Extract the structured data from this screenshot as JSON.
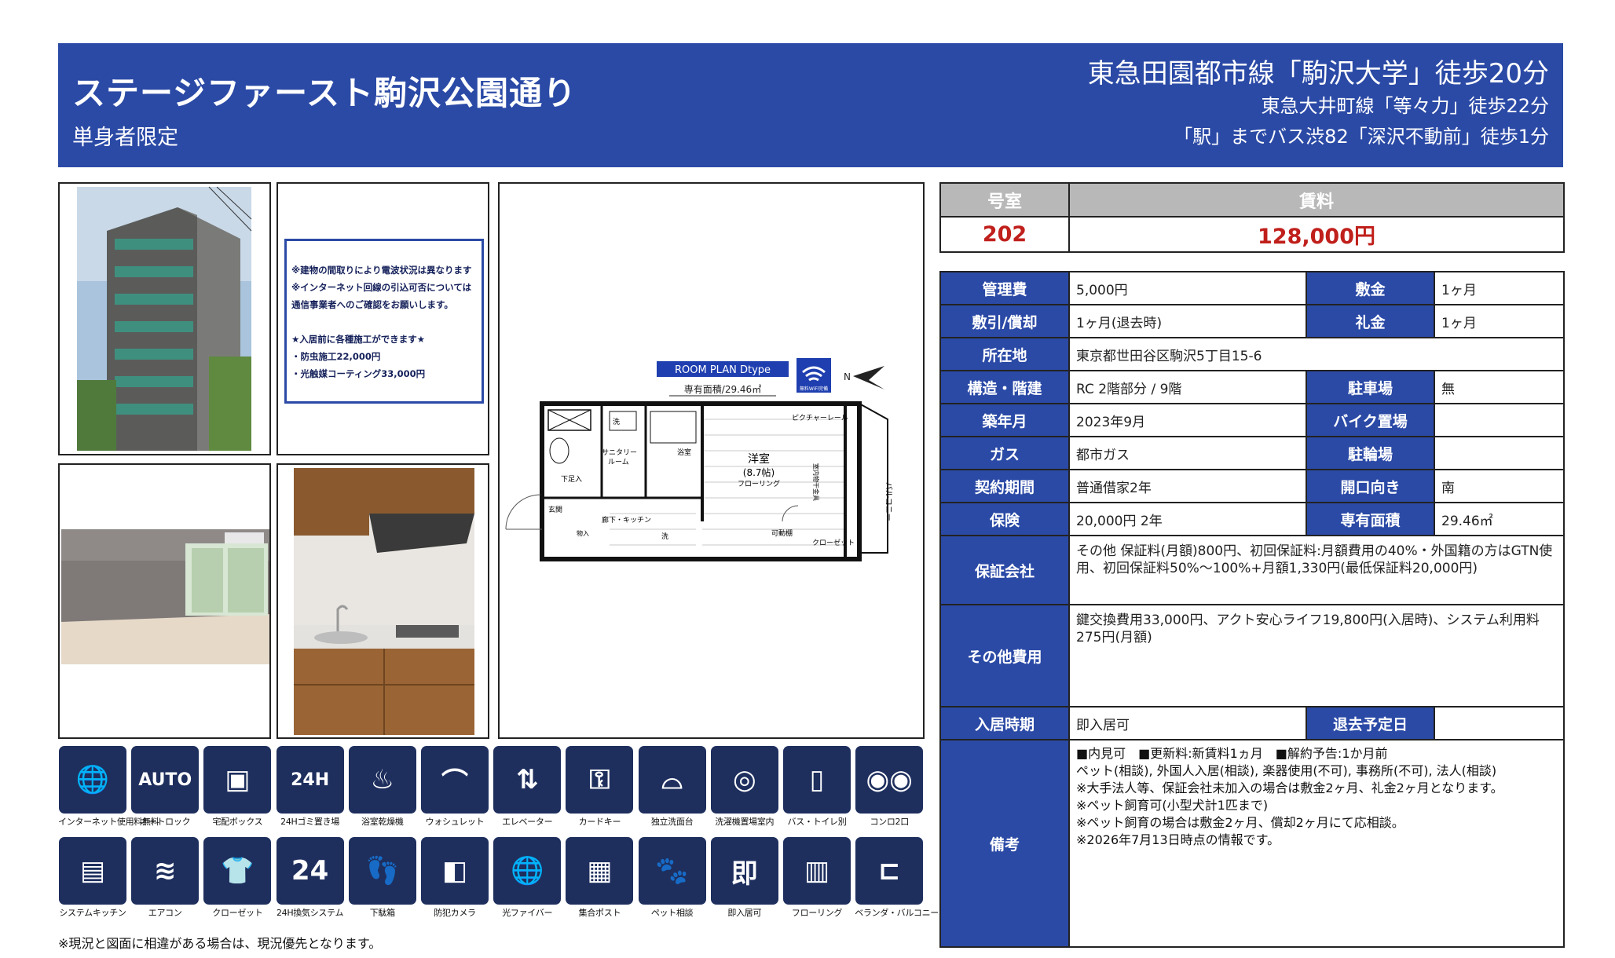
{
  "header": {
    "property_name": "ステージファースト駒沢公園通り",
    "restriction": "単身者限定",
    "access1": "東急田園都市線「駒沢大学」徒歩20分",
    "access2": "東急大井町線「等々力」徒歩22分",
    "access3": "「駅」までバス渋82「深沢不動前」徒歩1分"
  },
  "notice": {
    "lines": [
      "※建物の間取りにより電波状況は異なります",
      "※インターネット回線の引込可否については",
      "通信事業者へのご確認をお願いします。",
      "",
      "★入居前に各種施工ができます★",
      "・防虫施工22,000円",
      "・光触媒コーティング33,000円"
    ]
  },
  "floor_plan": {
    "badge": "ROOM PLAN  Dtype",
    "area": "専有面積/29.46㎡",
    "wifi_label": "無料WiFi完備",
    "north": "N",
    "room_yoshitsu": "洋室",
    "room_size": "(8.7帖)",
    "room_floor": "フローリング",
    "sanitary": "サニタリー",
    "sanitary2": "ルーム",
    "bath": "浴室",
    "wash": "洗",
    "geta": "下足入",
    "genkan": "玄関",
    "hall": "廊下・キッチン",
    "picture_rail": "ピクチャーレール",
    "closet": "クローゼット",
    "movable_shelf": "可動棚",
    "balcony": "バルコニー",
    "storage": "物入",
    "laundry": "洗",
    "indoor_clothes": "室内物干金具"
  },
  "rent": {
    "room_header": "号室",
    "rent_header": "賃料",
    "room": "202",
    "rent": "128,000円"
  },
  "info": {
    "kanrihi_label": "管理費",
    "kanrihi": "5,000円",
    "shikikin_label": "敷金",
    "shikikin": "1ヶ月",
    "shikibiki_label": "敷引/償却",
    "shikibiki": "1ヶ月(退去時)",
    "reikin_label": "礼金",
    "reikin": "1ヶ月",
    "address_label": "所在地",
    "address": "東京都世田谷区駒沢5丁目15-6",
    "structure_label": "構造・階建",
    "structure": "RC 2階部分 / 9階",
    "parking_label": "駐車場",
    "parking": "無",
    "built_label": "築年月",
    "built": "2023年9月",
    "bike_label": "バイク置場",
    "bike": "",
    "gas_label": "ガス",
    "gas": "都市ガス",
    "bicycle_label": "駐輪場",
    "bicycle": "",
    "contract_label": "契約期間",
    "contract": "普通借家2年",
    "direction_label": "開口向き",
    "direction": "南",
    "insurance_label": "保険",
    "insurance": "20,000円 2年",
    "area_label": "専有面積",
    "area": "29.46㎡",
    "guarantor_label": "保証会社",
    "guarantor": "その他 保証料(月額)800円、初回保証料:月額費用の40%・外国籍の方はGTN使用、初回保証料50%～100%+月額1,330円(最低保証料20,000円)",
    "other_fees_label": "その他費用",
    "other_fees": "鍵交換費用33,000円、アクト安心ライフ19,800円(入居時)、システム利用料275円(月額)",
    "movein_label": "入居時期",
    "movein": "即入居可",
    "moveout_label": "退去予定日",
    "moveout": "",
    "remarks_label": "備考",
    "remarks": [
      "■内見可　■更新料:新賃料1ヵ月　■解約予告:1か月前",
      "ペット(相談), 外国人入居(相談), 楽器使用(不可), 事務所(不可), 法人(相談)",
      "※大手法人等、保証会社未加入の場合は敷金2ヶ月、礼金2ヶ月となります。",
      "※ペット飼育可(小型犬計1匹まで)",
      "※ペット飼育の場合は敷金2ヶ月、償却2ヶ月にて応相談。",
      "※2026年7月13日時点の情報です。"
    ]
  },
  "equipment": [
    {
      "label": "インターネット使用料無料",
      "glyph": "🌐",
      "icon": "internet-free-icon"
    },
    {
      "label": "オートロック",
      "glyph": "AUTO",
      "icon": "auto-lock-icon"
    },
    {
      "label": "宅配ボックス",
      "glyph": "▣",
      "icon": "delivery-box-icon"
    },
    {
      "label": "24Hゴミ置き場",
      "glyph": "24H",
      "icon": "garbage-24h-icon"
    },
    {
      "label": "浴室乾燥機",
      "glyph": "♨",
      "icon": "bathroom-dryer-icon"
    },
    {
      "label": "ウォシュレット",
      "glyph": "⌒",
      "icon": "washlet-icon"
    },
    {
      "label": "エレベーター",
      "glyph": "⇅",
      "icon": "elevator-icon"
    },
    {
      "label": "カードキー",
      "glyph": "⚿",
      "icon": "card-key-icon"
    },
    {
      "label": "独立洗面台",
      "glyph": "⌓",
      "icon": "vanity-icon"
    },
    {
      "label": "洗濯機置場室内",
      "glyph": "◎",
      "icon": "washing-machine-icon"
    },
    {
      "label": "バス・トイレ別",
      "glyph": "▯",
      "icon": "separate-bath-toilet-icon"
    },
    {
      "label": "コンロ2口",
      "glyph": "◉◉",
      "icon": "two-burner-stove-icon"
    },
    {
      "label": "システムキッチン",
      "glyph": "▤",
      "icon": "system-kitchen-icon"
    },
    {
      "label": "エアコン",
      "glyph": "≋",
      "icon": "air-conditioner-icon"
    },
    {
      "label": "クローゼット",
      "glyph": "👕",
      "icon": "closet-icon"
    },
    {
      "label": "24H換気システム",
      "glyph": "24",
      "icon": "ventilation-24h-icon"
    },
    {
      "label": "下駄箱",
      "glyph": "👣",
      "icon": "shoe-box-icon"
    },
    {
      "label": "防犯カメラ",
      "glyph": "◧",
      "icon": "security-camera-icon"
    },
    {
      "label": "光ファイバー",
      "glyph": "🌐",
      "icon": "optical-fiber-icon"
    },
    {
      "label": "集合ポスト",
      "glyph": "▦",
      "icon": "mailbox-icon"
    },
    {
      "label": "ペット相談",
      "glyph": "🐾",
      "icon": "pet-consult-icon"
    },
    {
      "label": "即入居可",
      "glyph": "即",
      "icon": "immediate-move-in-icon"
    },
    {
      "label": "フローリング",
      "glyph": "▥",
      "icon": "flooring-icon"
    },
    {
      "label": "ベランダ・バルコニー",
      "glyph": "⊏",
      "icon": "balcony-icon"
    }
  ],
  "footnote": "※現況と図面に相違がある場合は、現況優先となります。",
  "colors": {
    "header_blue": "#2b4aa6",
    "label_blue": "#2b4aa6",
    "rent_red": "#c0201c",
    "icon_navy": "#1e2f5e",
    "table_header_gray": "#b8b8b8"
  }
}
